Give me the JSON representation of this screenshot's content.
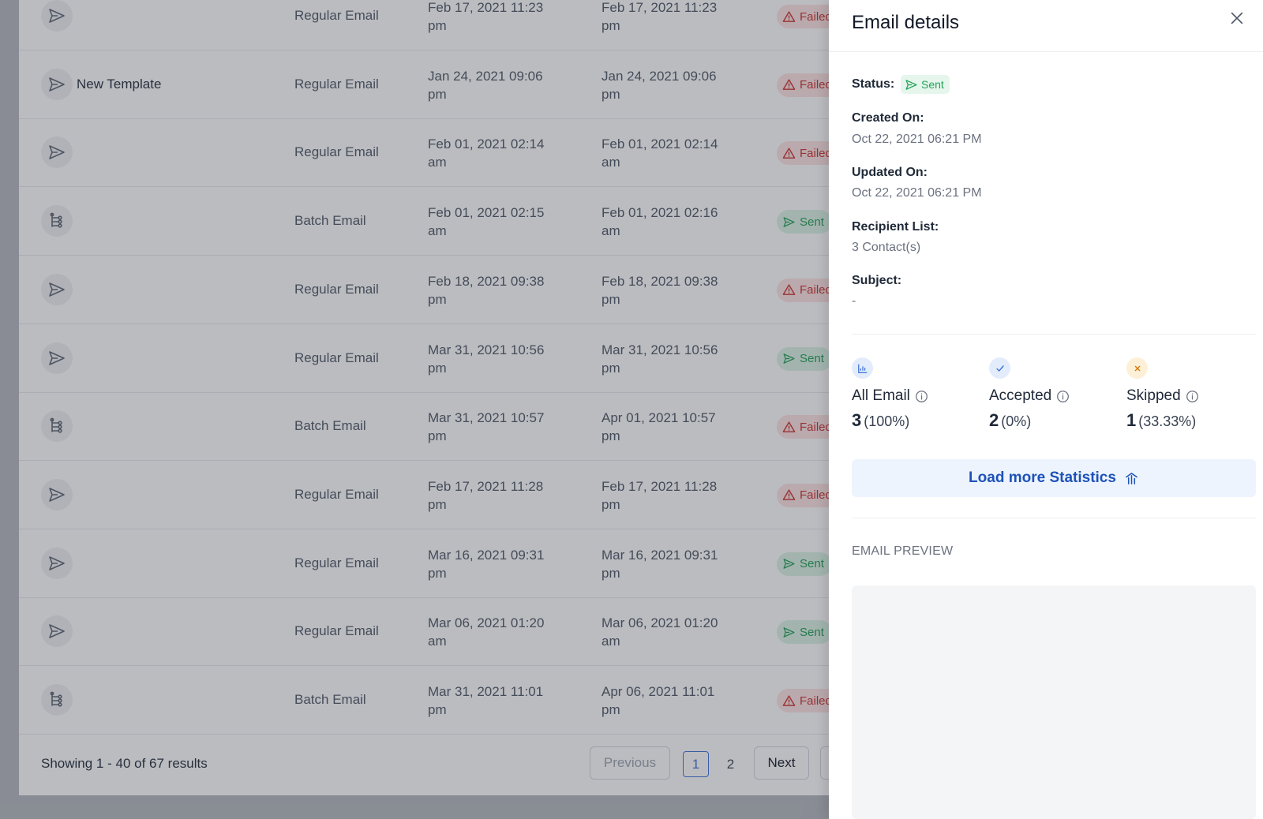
{
  "table": {
    "rows": [
      {
        "icon": "send-icon",
        "name": "",
        "type": "Regular Email",
        "created": [
          "Feb 17, 2021 11:23",
          "pm"
        ],
        "updated": [
          "Feb 17, 2021 11:23",
          "pm"
        ],
        "status": "Failed",
        "status_kind": "failed"
      },
      {
        "icon": "send-icon",
        "name": "New Template",
        "type": "Regular Email",
        "created": [
          "Jan 24, 2021 09:06",
          "pm"
        ],
        "updated": [
          "Jan 24, 2021 09:06",
          "pm"
        ],
        "status": "Failed",
        "status_kind": "failed"
      },
      {
        "icon": "send-icon",
        "name": "",
        "type": "Regular Email",
        "created": [
          "Feb 01, 2021 02:14",
          "am"
        ],
        "updated": [
          "Feb 01, 2021 02:14",
          "am"
        ],
        "status": "Failed",
        "status_kind": "failed"
      },
      {
        "icon": "batch-icon",
        "name": "",
        "type": "Batch Email",
        "created": [
          "Feb 01, 2021 02:15",
          "am"
        ],
        "updated": [
          "Feb 01, 2021 02:16",
          "am"
        ],
        "status": "Sent",
        "status_kind": "sent"
      },
      {
        "icon": "send-icon",
        "name": "",
        "type": "Regular Email",
        "created": [
          "Feb 18, 2021 09:38",
          "pm"
        ],
        "updated": [
          "Feb 18, 2021 09:38",
          "pm"
        ],
        "status": "Failed",
        "status_kind": "failed"
      },
      {
        "icon": "send-icon",
        "name": "",
        "type": "Regular Email",
        "created": [
          "Mar 31, 2021 10:56",
          "pm"
        ],
        "updated": [
          "Mar 31, 2021 10:56",
          "pm"
        ],
        "status": "Sent",
        "status_kind": "sent"
      },
      {
        "icon": "batch-icon",
        "name": "",
        "type": "Batch Email",
        "created": [
          "Mar 31, 2021 10:57",
          "pm"
        ],
        "updated": [
          "Apr 01, 2021 10:57",
          "pm"
        ],
        "status": "Failed",
        "status_kind": "failed"
      },
      {
        "icon": "send-icon",
        "name": "",
        "type": "Regular Email",
        "created": [
          "Feb 17, 2021 11:28",
          "pm"
        ],
        "updated": [
          "Feb 17, 2021 11:28",
          "pm"
        ],
        "status": "Failed",
        "status_kind": "failed"
      },
      {
        "icon": "send-icon",
        "name": "",
        "type": "Regular Email",
        "created": [
          "Mar 16, 2021 09:31",
          "pm"
        ],
        "updated": [
          "Mar 16, 2021 09:31",
          "pm"
        ],
        "status": "Sent",
        "status_kind": "sent"
      },
      {
        "icon": "send-icon",
        "name": "",
        "type": "Regular Email",
        "created": [
          "Mar 06, 2021 01:20",
          "am"
        ],
        "updated": [
          "Mar 06, 2021 01:20",
          "am"
        ],
        "status": "Sent",
        "status_kind": "sent"
      },
      {
        "icon": "batch-icon",
        "name": "",
        "type": "Batch Email",
        "created": [
          "Mar 31, 2021 11:01",
          "pm"
        ],
        "updated": [
          "Apr 06, 2021 11:01",
          "pm"
        ],
        "status": "Failed",
        "status_kind": "failed"
      }
    ],
    "footer": {
      "results_text": "Showing 1 - 40 of 67 results",
      "previous_label": "Previous",
      "pages": [
        "1",
        "2"
      ],
      "current_page": "1",
      "next_label": "Next"
    }
  },
  "drawer": {
    "title": "Email details",
    "status_label": "Status:",
    "status_value": "Sent",
    "created_label": "Created On:",
    "created_value": "Oct 22, 2021 06:21 PM",
    "updated_label": "Updated On:",
    "updated_value": "Oct 22, 2021 06:21 PM",
    "recipient_label": "Recipient List:",
    "recipient_value": "3 Contact(s)",
    "subject_label": "Subject:",
    "subject_value": "-",
    "stats": [
      {
        "label": "All Email",
        "count": "3",
        "percent": "(100%)",
        "icon": "chart-icon"
      },
      {
        "label": "Accepted",
        "count": "2",
        "percent": "(0%)",
        "icon": "check-icon"
      },
      {
        "label": "Skipped",
        "count": "1",
        "percent": "(33.33%)",
        "icon": "x-icon"
      }
    ],
    "load_more_label": "Load more Statistics",
    "preview_title": "EMAIL PREVIEW"
  },
  "colors": {
    "accent": "#1d52b8",
    "sent": "#22a35a",
    "failed": "#c9302c",
    "overlay": "#373c46"
  }
}
